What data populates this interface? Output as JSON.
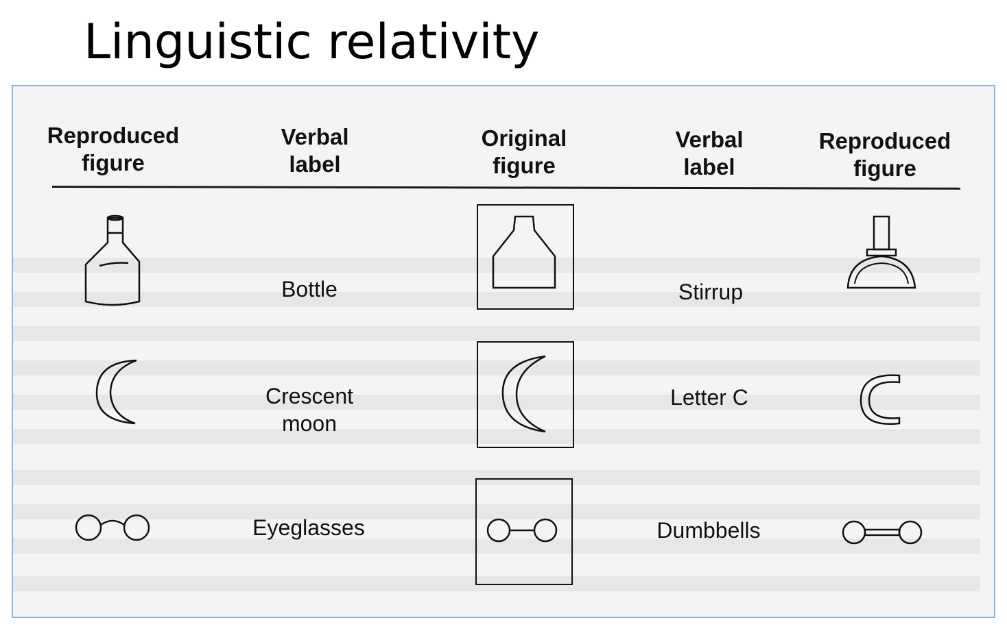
{
  "title": "Linguistic relativity",
  "headers": [
    "Reproduced figure",
    "Verbal label",
    "Original figure",
    "Verbal label",
    "Reproduced figure"
  ],
  "header_lines": [
    [
      "Reproduced",
      "figure"
    ],
    [
      "Verbal",
      "label"
    ],
    [
      "Original",
      "figure"
    ],
    [
      "Verbal",
      "label"
    ],
    [
      "Reproduced",
      "figure"
    ]
  ],
  "rows": [
    {
      "left_label": "Bottle",
      "right_label": "Stirrup",
      "left_icon": "bottle-icon",
      "original_icon": "original-bottle-stirrup-icon",
      "right_icon": "stirrup-icon"
    },
    {
      "left_label_lines": [
        "Crescent",
        "moon"
      ],
      "right_label": "Letter C",
      "left_icon": "crescent-moon-icon",
      "original_icon": "original-crescent-icon",
      "right_icon": "letter-c-icon"
    },
    {
      "left_label": "Eyeglasses",
      "right_label": "Dumbbells",
      "left_icon": "eyeglasses-icon",
      "original_icon": "original-circles-icon",
      "right_icon": "dumbbells-icon"
    }
  ],
  "colors": {
    "frame_border": "#8fb6d6",
    "ink": "#111111"
  }
}
